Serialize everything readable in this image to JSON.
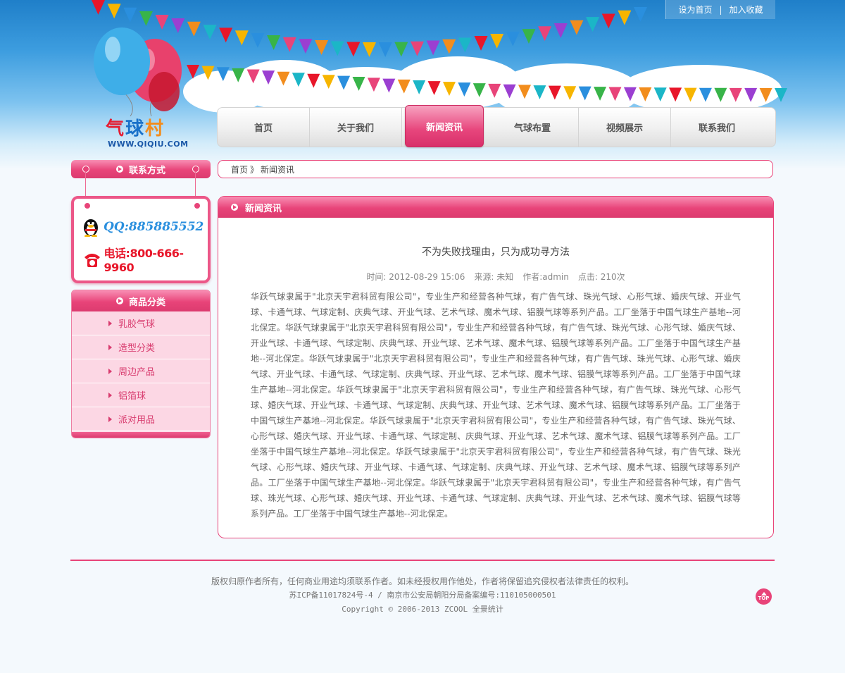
{
  "top_links": {
    "set_home": "设为首页",
    "separator": "|",
    "bookmark": "加入收藏"
  },
  "logo": {
    "text_cn_1": "气",
    "text_cn_2": "球",
    "text_cn_3": "村",
    "url_text": "WWW.QIQIU.COM"
  },
  "nav": {
    "items": [
      {
        "label": "首页"
      },
      {
        "label": "关于我们"
      },
      {
        "label": "新闻资讯",
        "active": true
      },
      {
        "label": "气球布置"
      },
      {
        "label": "视频展示"
      },
      {
        "label": "联系我们"
      }
    ]
  },
  "sidebar": {
    "contact_title": "联系方式",
    "qq_text": "QQ:885885552",
    "phone_text": "电话:800-666-9960",
    "category_title": "商品分类",
    "categories": [
      "乳胶气球",
      "造型分类",
      "周边产品",
      "铝箔球",
      "派对用品"
    ]
  },
  "breadcrumb": {
    "home": "首页",
    "arrow": "》",
    "current": "新闻资讯"
  },
  "main": {
    "header": "新闻资讯",
    "article_title": "不为失败找理由，只为成功寻方法",
    "meta": {
      "time": "时间: 2012-08-29 15:06",
      "source": "来源: 未知",
      "author": "作者:admin",
      "clicks": "点击: 210次"
    },
    "body": "华跃气球隶属于\"北京天宇君科贸有限公司\"，专业生产和经营各种气球，有广告气球、珠光气球、心形气球、婚庆气球、开业气球、卡通气球、气球定制、庆典气球、开业气球、艺术气球、魔术气球、铝膜气球等系列产品。工厂坐落于中国气球生产基地--河北保定。华跃气球隶属于\"北京天宇君科贸有限公司\"，专业生产和经营各种气球，有广告气球、珠光气球、心形气球、婚庆气球、开业气球、卡通气球、气球定制、庆典气球、开业气球、艺术气球、魔术气球、铝膜气球等系列产品。工厂坐落于中国气球生产基地--河北保定。华跃气球隶属于\"北京天宇君科贸有限公司\"，专业生产和经营各种气球，有广告气球、珠光气球、心形气球、婚庆气球、开业气球、卡通气球、气球定制、庆典气球、开业气球、艺术气球、魔术气球、铝膜气球等系列产品。工厂坐落于中国气球生产基地--河北保定。华跃气球隶属于\"北京天宇君科贸有限公司\"，专业生产和经营各种气球，有广告气球、珠光气球、心形气球、婚庆气球、开业气球、卡通气球、气球定制、庆典气球、开业气球、艺术气球、魔术气球、铝膜气球等系列产品。工厂坐落于中国气球生产基地--河北保定。华跃气球隶属于\"北京天宇君科贸有限公司\"，专业生产和经营各种气球，有广告气球、珠光气球、心形气球、婚庆气球、开业气球、卡通气球、气球定制、庆典气球、开业气球、艺术气球、魔术气球、铝膜气球等系列产品。工厂坐落于中国气球生产基地--河北保定。华跃气球隶属于\"北京天宇君科贸有限公司\"，专业生产和经营各种气球，有广告气球、珠光气球、心形气球、婚庆气球、开业气球、卡通气球、气球定制、庆典气球、开业气球、艺术气球、魔术气球、铝膜气球等系列产品。工厂坐落于中国气球生产基地--河北保定。华跃气球隶属于\"北京天宇君科贸有限公司\"，专业生产和经营各种气球，有广告气球、珠光气球、心形气球、婚庆气球、开业气球、卡通气球、气球定制、庆典气球、开业气球、艺术气球、魔术气球、铝膜气球等系列产品。工厂坐落于中国气球生产基地--河北保定。"
  },
  "footer": {
    "line1": "版权归原作者所有，任何商业用途均须联系作者。如未经授权用作他处，作者将保留追究侵权者法律责任的权利。",
    "line2": "苏ICP备11017824号-4 / 南京市公安局朝阳分局备案编号:110105000501",
    "line3": "Copyright © 2006-2013 ZCOOL 全景统计",
    "top_button": "TOP"
  },
  "colors": {
    "accent_pink": "#e84479",
    "sky_blue": "#3d9ddf"
  }
}
